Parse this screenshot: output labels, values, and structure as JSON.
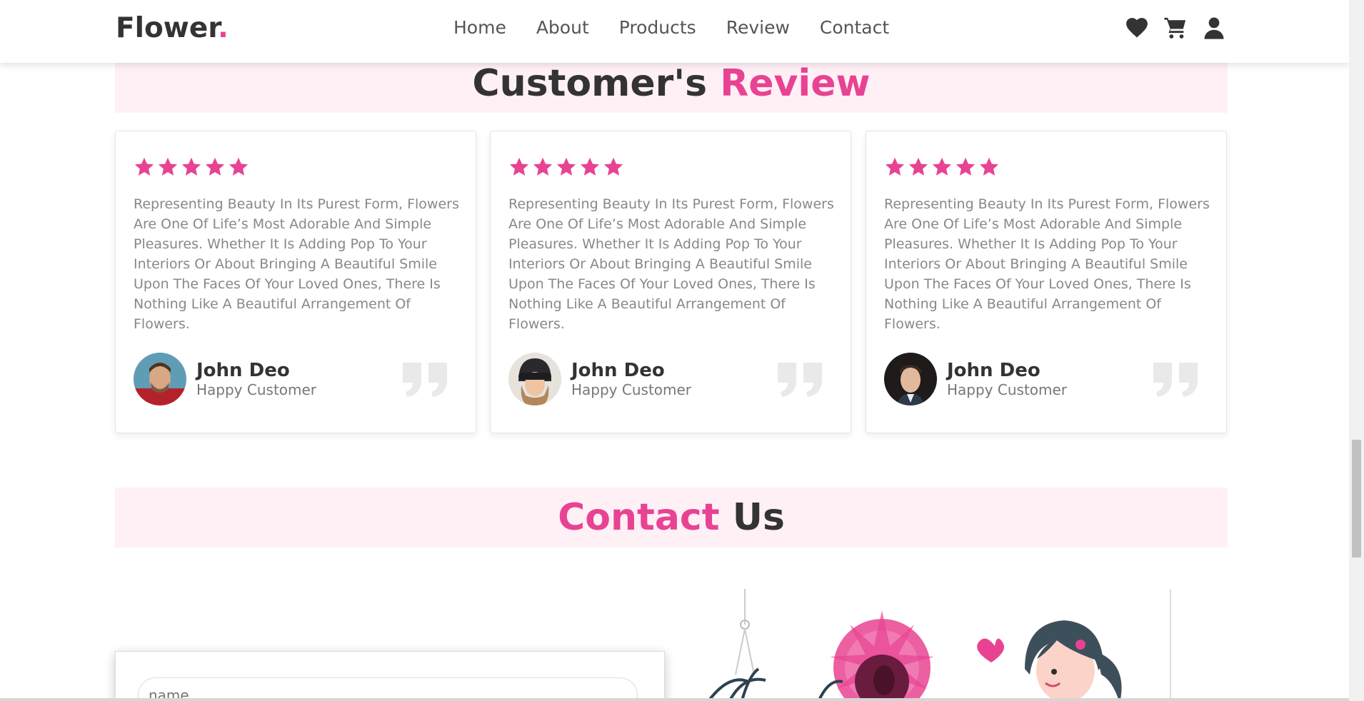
{
  "header": {
    "logo_text": "Flower",
    "logo_dot": ".",
    "nav": [
      "Home",
      "About",
      "Products",
      "Review",
      "Contact"
    ],
    "icons": [
      "heart-icon",
      "cart-icon",
      "user-icon"
    ]
  },
  "review": {
    "title_part1": "Customer's",
    "title_part2": "Review",
    "cards": [
      {
        "stars": 5,
        "text": "Representing Beauty In Its Purest Form, Flowers Are One Of Life’s Most Adorable And Simple Pleasures. Whether It Is Adding Pop To Your Interiors Or About Bringing A Beautiful Smile Upon The Faces Of Your Loved Ones, There Is Nothing Like A Beautiful Arrangement Of Flowers.",
        "name": "John Deo",
        "role": "Happy Customer"
      },
      {
        "stars": 5,
        "text": "Representing Beauty In Its Purest Form, Flowers Are One Of Life’s Most Adorable And Simple Pleasures. Whether It Is Adding Pop To Your Interiors Or About Bringing A Beautiful Smile Upon The Faces Of Your Loved Ones, There Is Nothing Like A Beautiful Arrangement Of Flowers.",
        "name": "John Deo",
        "role": "Happy Customer"
      },
      {
        "stars": 5,
        "text": "Representing Beauty In Its Purest Form, Flowers Are One Of Life’s Most Adorable And Simple Pleasures. Whether It Is Adding Pop To Your Interiors Or About Bringing A Beautiful Smile Upon The Faces Of Your Loved Ones, There Is Nothing Like A Beautiful Arrangement Of Flowers.",
        "name": "John Deo",
        "role": "Happy Customer"
      }
    ]
  },
  "contact": {
    "title_part1": "Contact",
    "title_part2": "Us",
    "name_placeholder": "name"
  },
  "colors": {
    "accent": "#e84393",
    "dark": "#333333",
    "heading_bg": "#fff0f6"
  }
}
